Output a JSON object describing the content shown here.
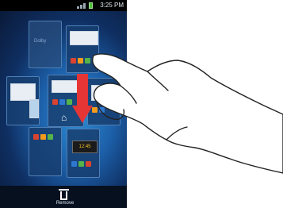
{
  "status_bar": {
    "time": "3:25 PM"
  },
  "panels": {
    "top_left_label": "Dolby"
  },
  "clock_widget": {
    "text": "12:45"
  },
  "bottom_bar": {
    "remove_label": "Remove"
  },
  "icons": [
    "signal-icon",
    "battery-icon",
    "home-icon",
    "trash-icon",
    "hand-gesture",
    "drag-arrow"
  ],
  "colors": {
    "arrow": "#e53535",
    "screen_bg": "#1c5fa8",
    "status_bar": "#000000"
  }
}
